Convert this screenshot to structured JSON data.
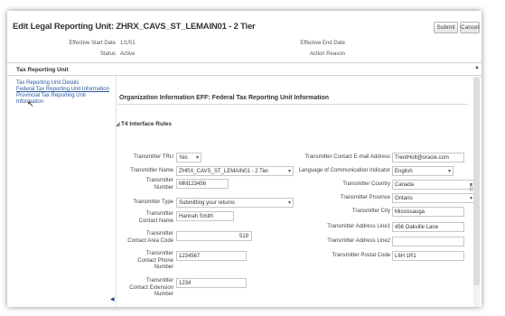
{
  "header": {
    "title": "Edit Legal Reporting Unit: ZHRX_CAVS_ST_LEMAIN01 - 2 Tier",
    "submit_label": "Submit",
    "cancel_label": "Cancel",
    "effective_start_label": "Effective Start Date",
    "effective_start_value": "1/1/51",
    "status_label": "Status",
    "status_value": "Active",
    "effective_end_label": "Effective End Date",
    "action_reason_label": "Action Reason"
  },
  "tab": {
    "label": "Tax Reporting Unit"
  },
  "nav": {
    "items": [
      {
        "label": "Tax Reporting Unit Details"
      },
      {
        "label": "Federal Tax Reporting Unit Information"
      },
      {
        "label": "Provincial Tax Reporting Unit"
      },
      {
        "label": "Information"
      }
    ]
  },
  "section": {
    "title": "Organization Information EFF: Federal Tax Reporting Unit Information",
    "subsection": "T4 Interface Rules"
  },
  "left_fields": {
    "tru_label": "Transmitter TRU",
    "tru_value": "Yes",
    "name_label": "Transmitter Name",
    "name_value": "ZHRX_CAVS_ST_LEMAIN01 - 2 Tier",
    "number_label_1": "Transmitter",
    "number_label_2": "Number",
    "number_value": "MM123456",
    "type_label": "Transmitter Type",
    "type_value": "Submitting your returns",
    "contact_name_label_1": "Transmitter",
    "contact_name_label_2": "Contact Name",
    "contact_name_value": "Hannah Smith",
    "area_code_label_1": "Transmitter",
    "area_code_label_2": "Contact Area Code",
    "area_code_value": "519",
    "phone_label_1": "Transmitter",
    "phone_label_2": "Contact Phone",
    "phone_label_3": "Number",
    "phone_value": "1234567",
    "ext_label_1": "Transmitter",
    "ext_label_2": "Contact Extension",
    "ext_label_3": "Number",
    "ext_value": "1234"
  },
  "right_fields": {
    "email_label": "Transmitter Contact E-mail Address",
    "email_value": "TrentHolt@oracle.com",
    "language_label": "Language of Communication Indicator",
    "language_value": "English",
    "country_label": "Transmitter Country",
    "country_value": "Canada",
    "province_label": "Transmitter Province",
    "province_value": "Ontario",
    "city_label": "Transmitter City",
    "city_value": "Mississauga",
    "addr1_label": "Transmitter Address Line1",
    "addr1_value": "456 Oakville Lane",
    "addr2_label": "Transmitter Address Line2",
    "addr2_value": "",
    "postal_label": "Transmitter Postal Code",
    "postal_value": "L6H 1R1"
  }
}
